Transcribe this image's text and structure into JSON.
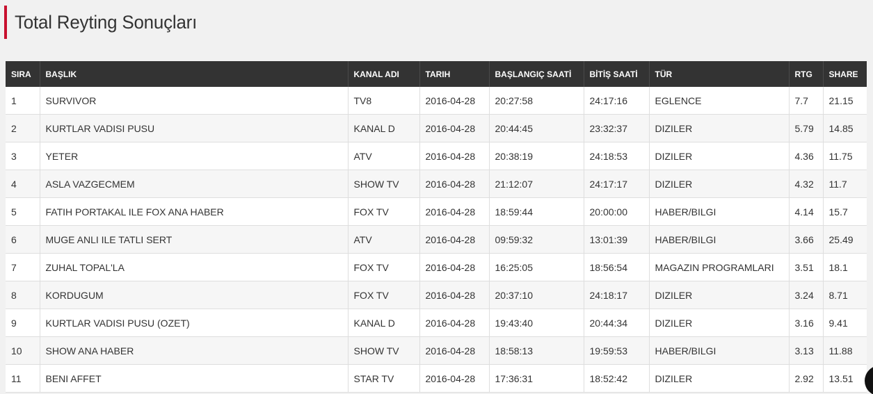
{
  "page": {
    "title": "Total Reyting Sonuçları",
    "accent_color": "#c8102e",
    "header_bg": "#333333"
  },
  "table": {
    "columns": [
      "SIRA",
      "BAŞLIK",
      "KANAL ADI",
      "TARIH",
      "BAŞLANGIÇ SAATİ",
      "BİTİŞ SAATİ",
      "TÜR",
      "RTG",
      "SHARE"
    ],
    "rows": [
      [
        "1",
        "SURVIVOR",
        "TV8",
        "2016-04-28",
        "20:27:58",
        "24:17:16",
        "EGLENCE",
        "7.7",
        "21.15"
      ],
      [
        "2",
        "KURTLAR VADISI PUSU",
        "KANAL D",
        "2016-04-28",
        "20:44:45",
        "23:32:37",
        "DIZILER",
        "5.79",
        "14.85"
      ],
      [
        "3",
        "YETER",
        "ATV",
        "2016-04-28",
        "20:38:19",
        "24:18:53",
        "DIZILER",
        "4.36",
        "11.75"
      ],
      [
        "4",
        "ASLA VAZGECMEM",
        "SHOW TV",
        "2016-04-28",
        "21:12:07",
        "24:17:17",
        "DIZILER",
        "4.32",
        "11.7"
      ],
      [
        "5",
        "FATIH PORTAKAL ILE FOX ANA HABER",
        "FOX TV",
        "2016-04-28",
        "18:59:44",
        "20:00:00",
        "HABER/BILGI",
        "4.14",
        "15.7"
      ],
      [
        "6",
        "MUGE ANLI ILE TATLI SERT",
        "ATV",
        "2016-04-28",
        "09:59:32",
        "13:01:39",
        "HABER/BILGI",
        "3.66",
        "25.49"
      ],
      [
        "7",
        "ZUHAL TOPAL'LA",
        "FOX TV",
        "2016-04-28",
        "16:25:05",
        "18:56:54",
        "MAGAZIN PROGRAMLARI",
        "3.51",
        "18.1"
      ],
      [
        "8",
        "KORDUGUM",
        "FOX TV",
        "2016-04-28",
        "20:37:10",
        "24:18:17",
        "DIZILER",
        "3.24",
        "8.71"
      ],
      [
        "9",
        "KURTLAR VADISI PUSU (OZET)",
        "KANAL D",
        "2016-04-28",
        "19:43:40",
        "20:44:34",
        "DIZILER",
        "3.16",
        "9.41"
      ],
      [
        "10",
        "SHOW ANA HABER",
        "SHOW TV",
        "2016-04-28",
        "18:58:13",
        "19:59:53",
        "HABER/BILGI",
        "3.13",
        "11.88"
      ],
      [
        "11",
        "BENI AFFET",
        "STAR TV",
        "2016-04-28",
        "17:36:31",
        "18:52:42",
        "DIZILER",
        "2.92",
        "13.51"
      ]
    ]
  }
}
